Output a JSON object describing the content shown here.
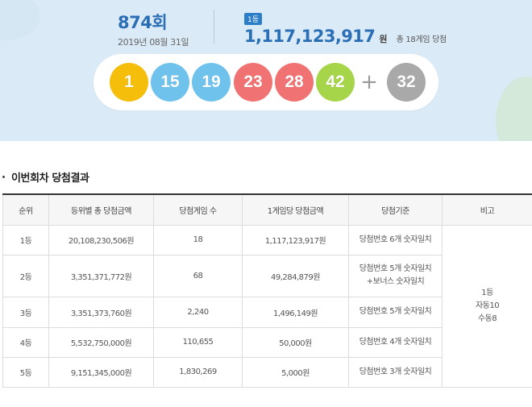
{
  "draw": {
    "number": "874회",
    "date": "2019년 08월 31일"
  },
  "prize": {
    "rank_badge": "1등",
    "amount": "1,117,123,917",
    "unit": "원",
    "note": "총 18게임 당첨"
  },
  "balls": [
    {
      "number": "1",
      "color": "#f5be0b"
    },
    {
      "number": "15",
      "color": "#6ec2ec"
    },
    {
      "number": "19",
      "color": "#6ec2ec"
    },
    {
      "number": "23",
      "color": "#f07272"
    },
    {
      "number": "28",
      "color": "#f07272"
    },
    {
      "number": "42",
      "color": "#a7d54a"
    }
  ],
  "plus_symbol": "+",
  "bonus_ball": {
    "number": "32",
    "color": "#a9a9a9"
  },
  "section_title": "이번회차 당첨결과",
  "table": {
    "headers": [
      "순위",
      "등위별 총 당첨금액",
      "당첨게임 수",
      "1게임당 당첨금액",
      "당첨기준",
      "비고"
    ],
    "rows": [
      {
        "rank": "1등",
        "total": "20,108,230,506원",
        "games": "18",
        "per_game": "1,117,123,917원",
        "criteria": [
          "당첨번호 6개 숫자일치"
        ]
      },
      {
        "rank": "2등",
        "total": "3,351,371,772원",
        "games": "68",
        "per_game": "49,284,879원",
        "criteria": [
          "당첨번호 5개 숫자일치",
          "+보너스 숫자일치"
        ]
      },
      {
        "rank": "3등",
        "total": "3,351,373,760원",
        "games": "2,240",
        "per_game": "1,496,149원",
        "criteria": [
          "당첨번호 5개 숫자일치"
        ]
      },
      {
        "rank": "4등",
        "total": "5,532,750,000원",
        "games": "110,655",
        "per_game": "50,000원",
        "criteria": [
          "당첨번호 4개 숫자일치"
        ]
      },
      {
        "rank": "5등",
        "total": "9,151,345,000원",
        "games": "1,830,269",
        "per_game": "5,000원",
        "criteria": [
          "당첨번호 3개 숫자일치"
        ]
      }
    ],
    "remarks": [
      "1등",
      "자동10",
      "수동8"
    ]
  }
}
